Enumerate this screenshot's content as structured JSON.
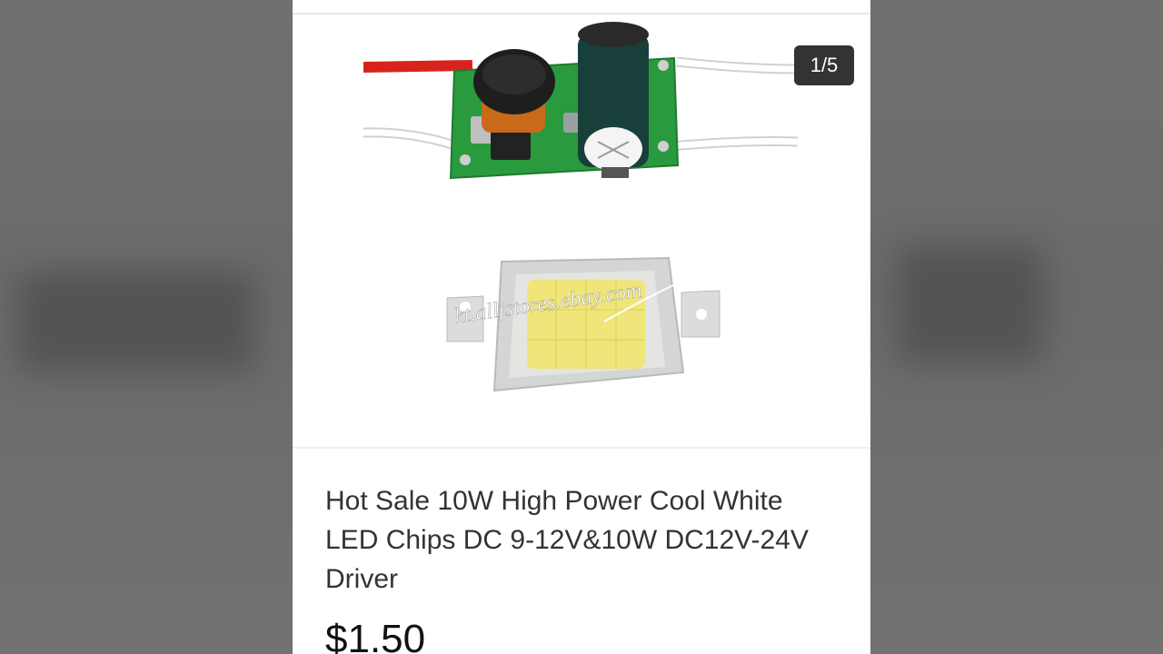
{
  "gallery": {
    "counter": "1/5",
    "watermark": "kt.alljstores.ebay.com"
  },
  "product": {
    "title": "Hot Sale 10W High Power Cool White LED Chips DC 9-12V&10W DC12V-24V Driver",
    "price": "$1.50"
  },
  "colors": {
    "pcb_green": "#2a9a3f",
    "wire_red": "#d8231c",
    "capacitor": "#183f3a",
    "led_yellow": "#efe57a",
    "counter_bg": "#333333"
  }
}
